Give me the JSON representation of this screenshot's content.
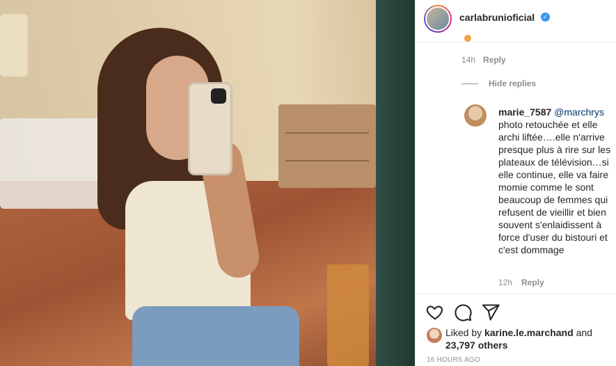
{
  "post": {
    "username": "carlabrunioficial",
    "verified_icon": "verified-badge-icon"
  },
  "thread": {
    "prev_time": "14h",
    "prev_reply": "Reply",
    "hide_replies": "Hide replies"
  },
  "comment": {
    "username": "marie_7587",
    "mention": "@marchrys",
    "text": "photo retouchée et elle archi liftée….elle n'arrive presque plus à rire sur les plateaux de télévision…si elle continue, elle va faire momie comme le sont beaucoup de femmes qui refusent de vieillir et bien souvent s'enlaidissent à force d'user du bistouri et c'est dommage",
    "time": "12h",
    "reply": "Reply"
  },
  "actions": {
    "like_icon": "heart-icon",
    "comment_icon": "comment-icon",
    "share_icon": "send-icon"
  },
  "likes": {
    "prefix": "Liked by",
    "user": "karine.le.marchand",
    "and": "and",
    "others": "23,797 others"
  },
  "posted_ago": "16 HOURS AGO"
}
